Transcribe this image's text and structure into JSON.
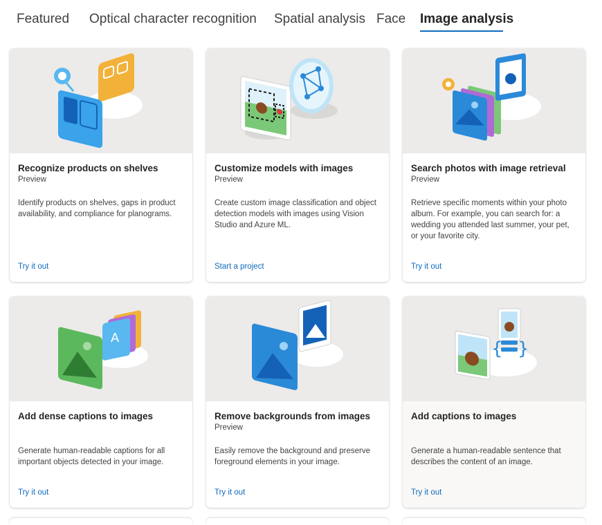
{
  "tabs": [
    {
      "label": "Featured"
    },
    {
      "label": "Optical character recognition"
    },
    {
      "label": "Spatial analysis"
    },
    {
      "label": "Face"
    },
    {
      "label": "Image analysis",
      "active": true
    }
  ],
  "colors": {
    "accent": "#0f6cbd",
    "image_bg": "#ecebea"
  },
  "cards": [
    {
      "title": "Recognize products on shelves",
      "badge": "Preview",
      "description": "Identify products on shelves, gaps in product availability, and compliance for planograms.",
      "link": "Try it out",
      "icon": "product-shelf-illustration"
    },
    {
      "title": "Customize models with images",
      "badge": "Preview",
      "description": "Create custom image classification and object detection models with images using Vision Studio and Azure ML.",
      "link": "Start a project",
      "icon": "custom-model-illustration"
    },
    {
      "title": "Search photos with image retrieval",
      "badge": "Preview",
      "description": "Retrieve specific moments within your photo album. For example, you can search for: a wedding you attended last summer, your pet, or your favorite city.",
      "link": "Try it out",
      "icon": "photo-retrieval-illustration"
    },
    {
      "title": "Add dense captions to images",
      "badge": "",
      "description": "Generate human-readable captions for all important objects detected in your image.",
      "link": "Try it out",
      "icon": "dense-captions-illustration"
    },
    {
      "title": "Remove backgrounds from images",
      "badge": "Preview",
      "description": "Easily remove the background and preserve foreground elements in your image.",
      "link": "Try it out",
      "icon": "remove-background-illustration"
    },
    {
      "title": "Add captions to images",
      "badge": "",
      "description": "Generate a human-readable sentence that describes the content of an image.",
      "link": "Try it out",
      "icon": "image-caption-illustration"
    }
  ]
}
